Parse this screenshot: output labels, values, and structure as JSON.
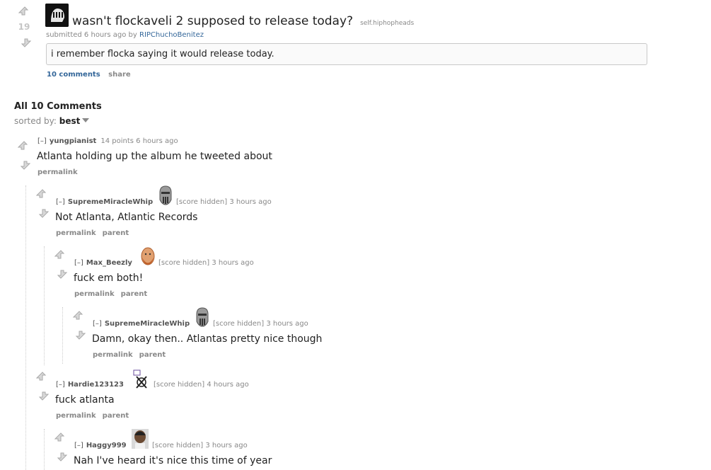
{
  "post": {
    "score": "19",
    "title": "wasn't flockaveli 2 supposed to release today?",
    "domain": "self.hiphopheads",
    "tagline_prefix": "submitted 6 hours ago by",
    "author": "RIPChuchoBenitez",
    "selftext": "i remember flocka saying it would release today.",
    "comments_link": "10 comments",
    "share_link": "share"
  },
  "comments_header": {
    "title": "All 10 Comments",
    "sorted_label": "sorted by:",
    "sort_value": "best"
  },
  "comments": [
    {
      "toggle": "[–]",
      "author": "yungpianist",
      "score": "14 points",
      "time": "6 hours ago",
      "body": "Atlanta holding up the album he tweeted about",
      "permalink": "permalink",
      "parent": ""
    },
    {
      "toggle": "[–]",
      "author": "SupremeMiracleWhip",
      "score": "[score hidden]",
      "time": "3 hours ago",
      "body": "Not Atlanta, Atlantic Records",
      "permalink": "permalink",
      "parent": "parent"
    },
    {
      "toggle": "[–]",
      "author": "Max_Beezly",
      "score": "[score hidden]",
      "time": "3 hours ago",
      "body": "fuck em both!",
      "permalink": "permalink",
      "parent": "parent"
    },
    {
      "toggle": "[–]",
      "author": "SupremeMiracleWhip",
      "score": "[score hidden]",
      "time": "3 hours ago",
      "body": "Damn, okay then.. Atlantas pretty nice though",
      "permalink": "permalink",
      "parent": "parent"
    },
    {
      "toggle": "[–]",
      "author": "Hardie123123",
      "score": "[score hidden]",
      "time": "4 hours ago",
      "body": "fuck atlanta",
      "permalink": "permalink",
      "parent": "parent"
    },
    {
      "toggle": "[–]",
      "author": "Haggy999",
      "score": "[score hidden]",
      "time": "3 hours ago",
      "body": "Nah I've heard it's nice this time of year",
      "permalink": "",
      "parent": ""
    }
  ],
  "colors": {
    "link": "#336699",
    "muted": "#888888",
    "text": "#222222",
    "arrow": "#c6c6c6"
  }
}
